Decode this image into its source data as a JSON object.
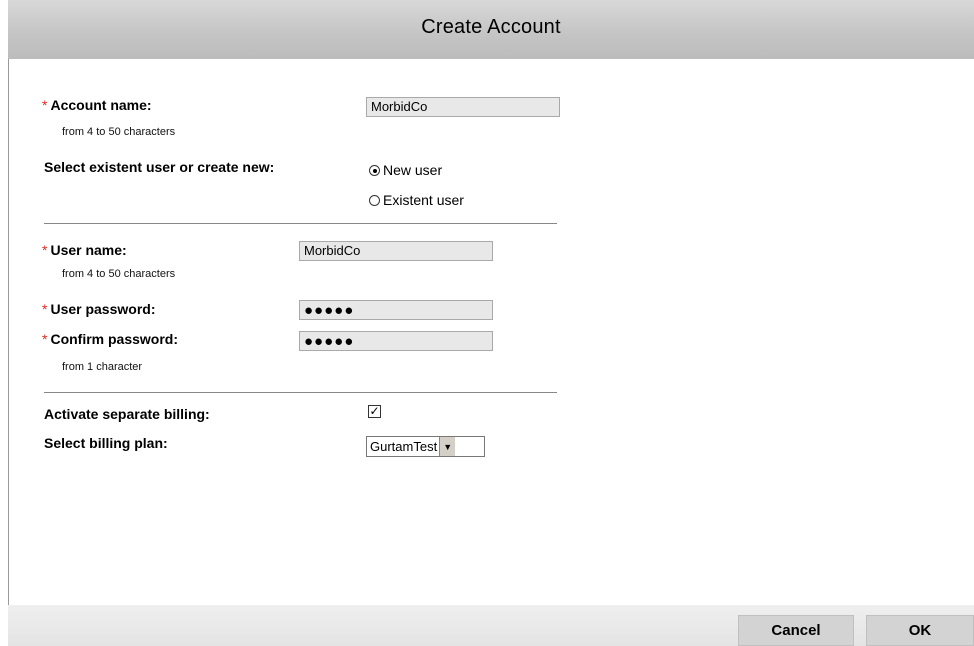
{
  "dialog": {
    "title": "Create Account"
  },
  "account": {
    "name_label": "Account name:",
    "name_value": "MorbidCo",
    "name_hint": "from 4 to 50 characters",
    "required_mark": "*"
  },
  "user_select": {
    "label": "Select existent user or create new:",
    "options": [
      "New user",
      "Existent user"
    ],
    "selected": "New user"
  },
  "user": {
    "name_label": "User name:",
    "name_value": "MorbidCo",
    "name_hint": "from 4 to 50 characters",
    "password_label": "User password:",
    "password_value": "●●●●●",
    "confirm_label": "Confirm password:",
    "confirm_value": "●●●●●",
    "password_hint": "from 1 character"
  },
  "billing": {
    "separate_label": "Activate separate billing:",
    "separate_checked": true,
    "check_glyph": "✓",
    "plan_label": "Select billing plan:",
    "plan_value": "GurtamTest",
    "dropdown_glyph": "▼"
  },
  "buttons": {
    "cancel": "Cancel",
    "ok": "OK"
  }
}
